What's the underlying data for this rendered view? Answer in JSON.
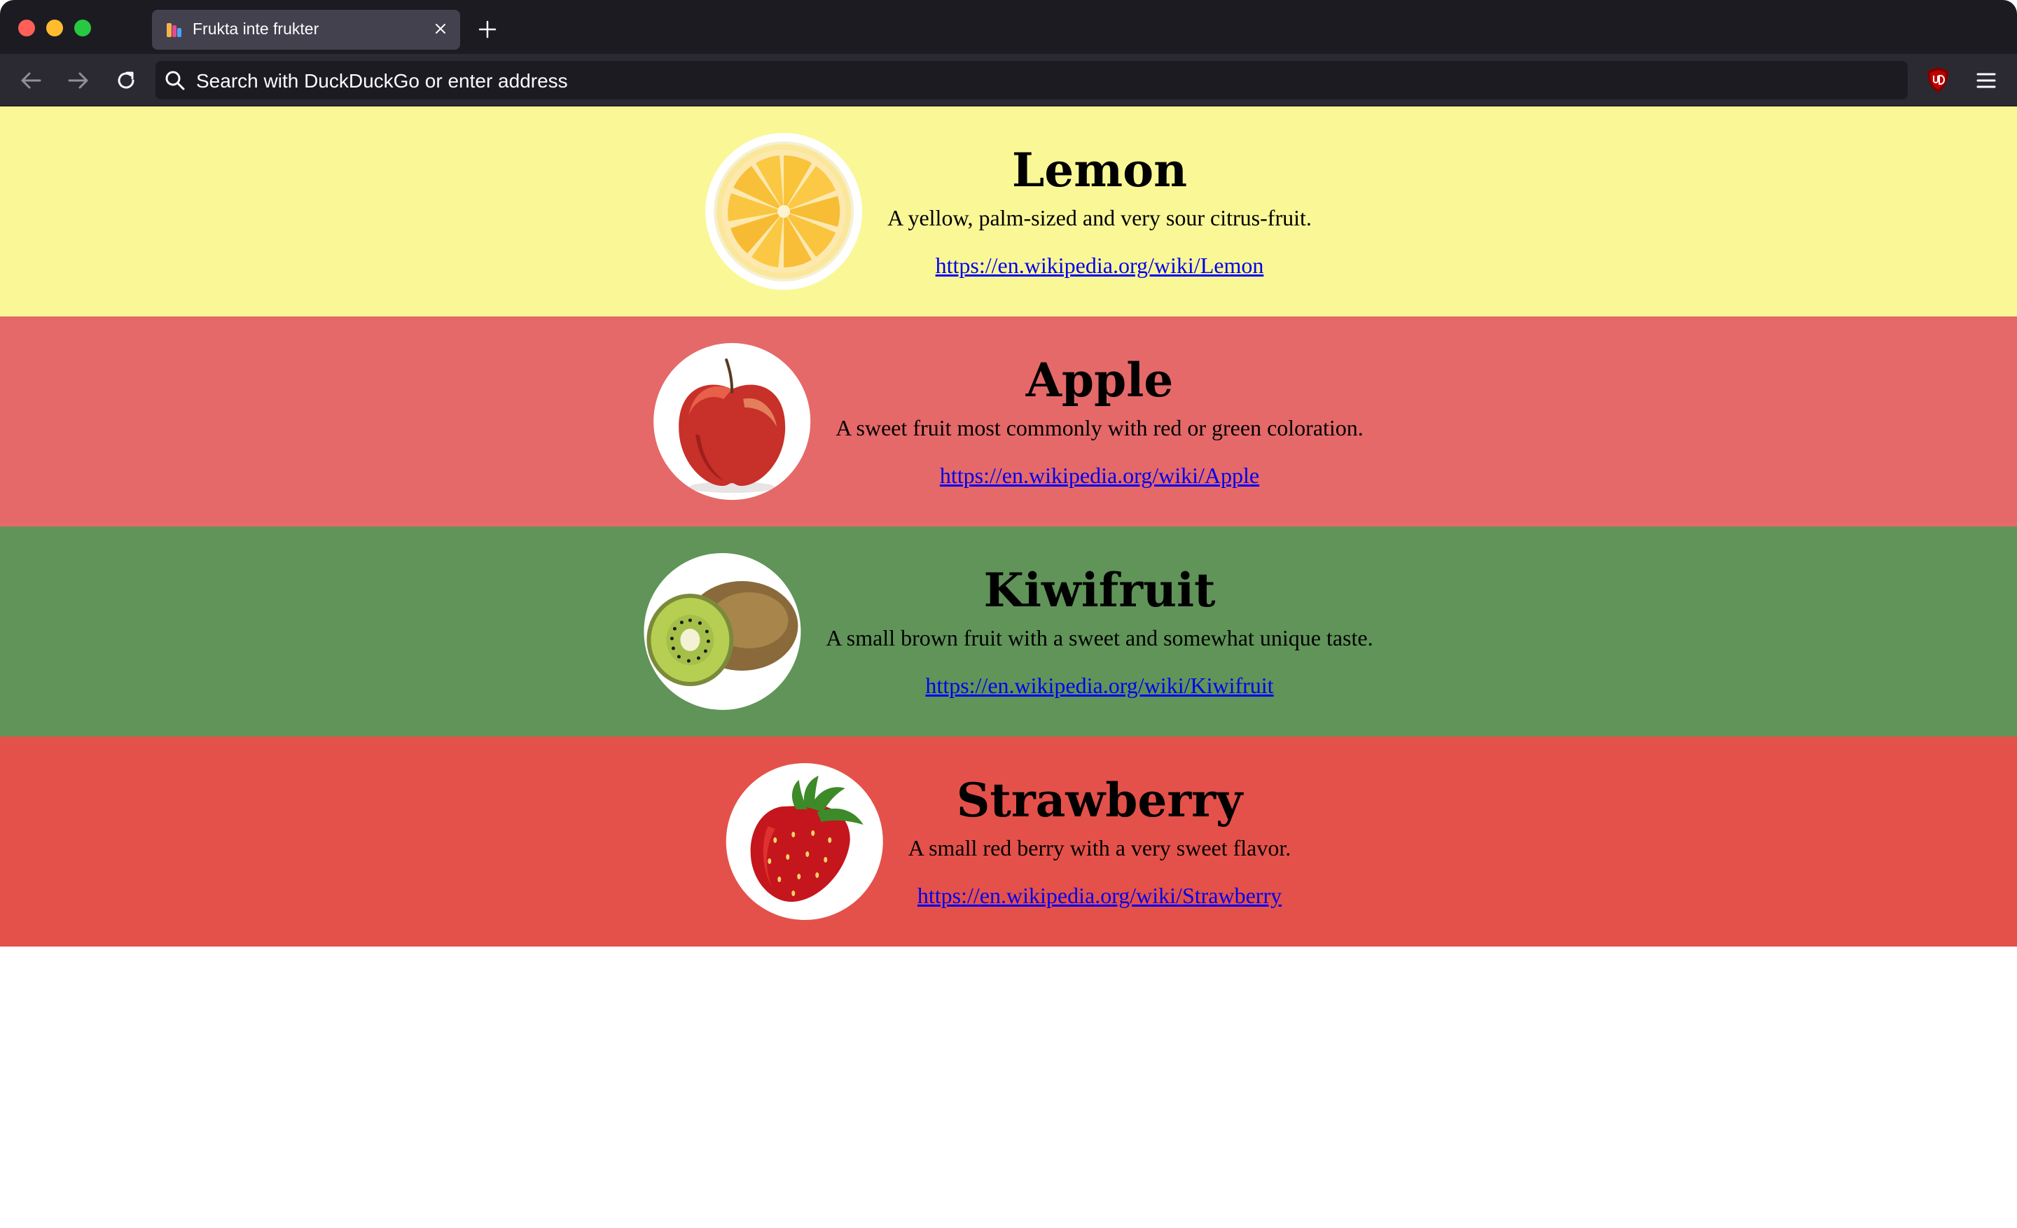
{
  "browser": {
    "tab_title": "Frukta inte frukter",
    "url_placeholder": "Search with DuckDuckGo or enter address"
  },
  "colors": {
    "lemon_bg": "#faf797",
    "apple_bg": "#e56969",
    "kiwi_bg": "#609459",
    "strawberry_bg": "#e4514a",
    "link": "#0000ee"
  },
  "fruits": [
    {
      "name": "Lemon",
      "description": "A yellow, palm-sized and very sour citrus-fruit.",
      "link": "https://en.wikipedia.org/wiki/Lemon",
      "icon": "lemon-slice-image"
    },
    {
      "name": "Apple",
      "description": "A sweet fruit most commonly with red or green coloration.",
      "link": "https://en.wikipedia.org/wiki/Apple",
      "icon": "apple-image"
    },
    {
      "name": "Kiwifruit",
      "description": "A small brown fruit with a sweet and somewhat unique taste.",
      "link": "https://en.wikipedia.org/wiki/Kiwifruit",
      "icon": "kiwi-image"
    },
    {
      "name": "Strawberry",
      "description": "A small red berry with a very sweet flavor.",
      "link": "https://en.wikipedia.org/wiki/Strawberry",
      "icon": "strawberry-image"
    }
  ]
}
